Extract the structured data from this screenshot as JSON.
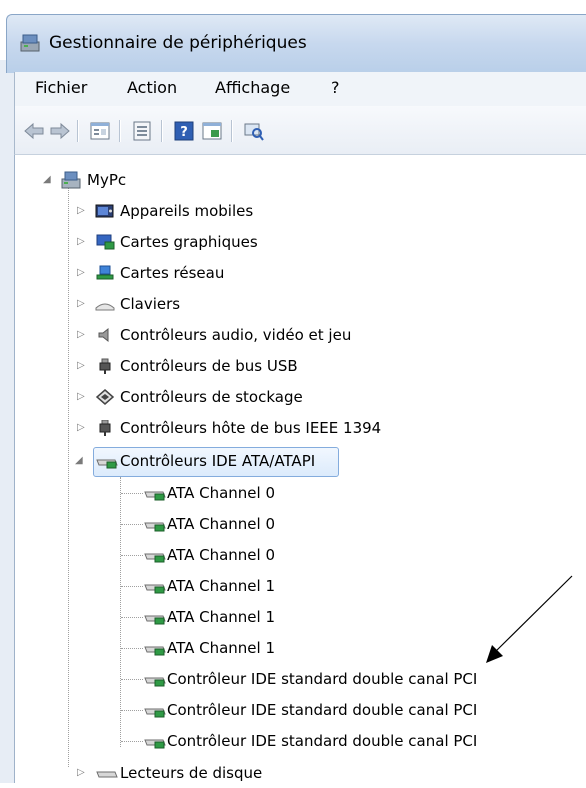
{
  "window": {
    "title": "Gestionnaire de périphériques"
  },
  "menu": [
    "Fichier",
    "Action",
    "Affichage",
    "?"
  ],
  "toolbar": [
    "back-arrow-icon",
    "forward-arrow-icon",
    "properties-icon",
    "view-icon",
    "help-icon",
    "update-driver-icon",
    "scan-hardware-icon"
  ],
  "tree": {
    "root": "MyPc",
    "categories": [
      "Appareils mobiles",
      "Cartes graphiques",
      "Cartes réseau",
      "Claviers",
      "Contrôleurs audio, vidéo et jeu",
      "Contrôleurs de bus USB",
      "Contrôleurs de stockage",
      "Contrôleurs hôte de bus IEEE 1394",
      "Contrôleurs IDE ATA/ATAPI"
    ],
    "ide_children": [
      "ATA Channel 0",
      "ATA Channel 0",
      "ATA Channel 0",
      "ATA Channel 1",
      "ATA Channel 1",
      "ATA Channel 1",
      "Contrôleur IDE standard double canal PCI",
      "Contrôleur IDE standard double canal PCI",
      "Contrôleur IDE standard double canal PCI"
    ],
    "last": "Lecteurs de disque"
  },
  "colors": {
    "selection": "#dcebfc",
    "titlebar": "#c7d8ee",
    "annotation": "#000000"
  }
}
